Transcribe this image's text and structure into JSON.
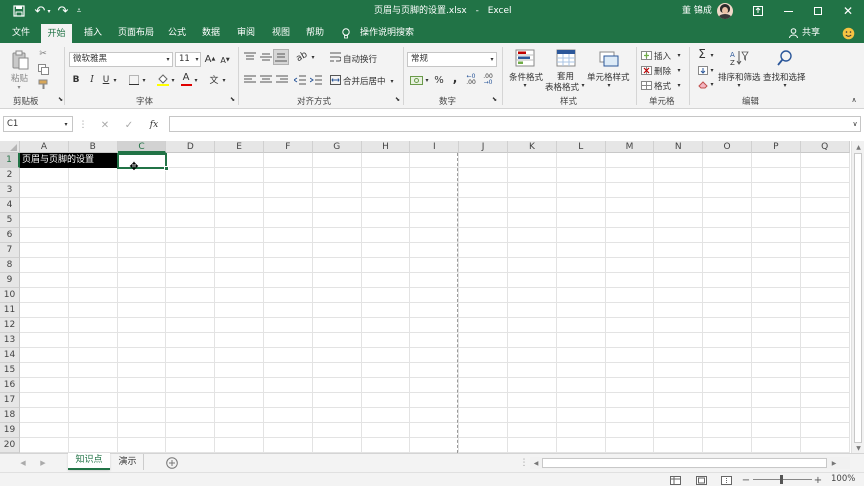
{
  "titlebar": {
    "filename": "页眉与页脚的设置.xlsx",
    "separator": "-",
    "app": "Excel",
    "user": "董 锦成",
    "bg_color": "#217346"
  },
  "tabs": [
    "文件",
    "开始",
    "插入",
    "页面布局",
    "公式",
    "数据",
    "审阅",
    "视图",
    "帮助"
  ],
  "active_tab": "开始",
  "tell_me": "操作说明搜索",
  "share": "共享",
  "ribbon": {
    "clipboard": {
      "paste": "粘贴",
      "group": "剪贴板"
    },
    "font": {
      "name": "微软雅黑",
      "size": "11",
      "bold": "B",
      "italic": "I",
      "underline": "U",
      "grow": "A",
      "shrink": "A",
      "font_color_glyph": "A",
      "group": "字体"
    },
    "align": {
      "wrap": "自动换行",
      "merge": "合并后居中",
      "group": "对齐方式"
    },
    "number": {
      "format": "常规",
      "percent": "%",
      "comma": ",",
      "group": "数字"
    },
    "styles": {
      "conditional": "条件格式",
      "table_line1": "套用",
      "table_line2": "表格格式",
      "cell_styles": "单元格样式",
      "group": "样式"
    },
    "cells": {
      "insert": "插入",
      "delete": "删除",
      "format": "格式",
      "group": "单元格"
    },
    "editing": {
      "sum": "Σ",
      "sort_filter": "排序和筛选",
      "find_select": "查找和选择",
      "group": "编辑"
    }
  },
  "formula_bar": {
    "name_box": "C1",
    "fx": "fx",
    "content": ""
  },
  "columns": [
    "A",
    "B",
    "C",
    "D",
    "E",
    "F",
    "G",
    "H",
    "I",
    "J",
    "K",
    "L",
    "M",
    "N",
    "O",
    "P",
    "Q"
  ],
  "rows": [
    "1",
    "2",
    "3",
    "4",
    "5",
    "6",
    "7",
    "8",
    "9",
    "10",
    "11",
    "12",
    "13",
    "14",
    "15",
    "16",
    "17",
    "18",
    "19",
    "20"
  ],
  "cells": {
    "A1": "页眉与页脚的设置"
  },
  "sheets": [
    "知识点",
    "演示"
  ],
  "active_sheet": "知识点",
  "zoom": "100%",
  "accent_color": "#217346"
}
